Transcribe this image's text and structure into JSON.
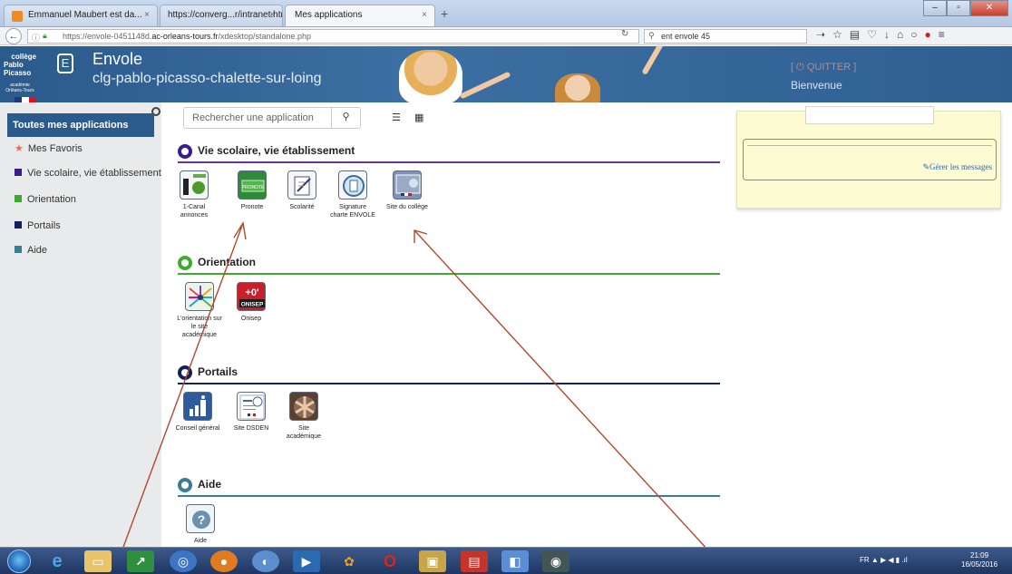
{
  "browser": {
    "tabs": [
      {
        "label": "Emmanuel Maubert est da...",
        "active": false
      },
      {
        "label": "https://converg...r/intranet.html",
        "active": false
      },
      {
        "label": "Mes applications",
        "active": true
      }
    ],
    "tab_close": "×",
    "new_tab": "+",
    "url_prefix": "https://envole-0451148d.",
    "url_domain": "ac-orleans-tours.fr",
    "url_path": "/xdesktop/standalone.php",
    "search_value": "ent envole 45"
  },
  "header": {
    "logo_line1": "collège",
    "logo_line2": "Pablo Picasso",
    "logo_academy": "académie Orléans-Tours",
    "app_name": "Envole",
    "site_name": "clg-pablo-picasso-chalette-sur-loing",
    "quit": "[ ⏻  QUITTER ]",
    "welcome": "Bienvenue"
  },
  "sidebar": {
    "title": "Toutes mes applications",
    "items": [
      {
        "label": "Mes Favoris",
        "color": "#e26d5c",
        "icon": "star-icon"
      },
      {
        "label": "Vie scolaire, vie établissement",
        "color": "#3a1c8f",
        "icon": "square-icon"
      },
      {
        "label": "Orientation",
        "color": "#3fab2e",
        "icon": "square-icon"
      },
      {
        "label": "Portails",
        "color": "#13225c",
        "icon": "square-icon"
      },
      {
        "label": "Aide",
        "color": "#3b7d95",
        "icon": "square-icon"
      }
    ]
  },
  "search": {
    "placeholder": "Rechercher une application"
  },
  "sections": [
    {
      "title": "Vie scolaire, vie établissement",
      "color": "#6a3596",
      "apps": [
        {
          "label": "1-Canal annonces"
        },
        {
          "label": "Pronote",
          "icon_text": "PRONOTE"
        },
        {
          "label": "Scolarité"
        },
        {
          "label": "Signature charte ENVOLE"
        },
        {
          "label": "Site du collège"
        }
      ]
    },
    {
      "title": "Orientation",
      "color": "#3fab2e",
      "apps": [
        {
          "label": "L'orientation sur le site académique"
        },
        {
          "label": "Onisep",
          "icon_text": "ONISEP"
        }
      ]
    },
    {
      "title": "Portails",
      "color": "#13225c",
      "apps": [
        {
          "label": "Conseil général"
        },
        {
          "label": "Site DSDEN"
        },
        {
          "label": "Site académique"
        }
      ]
    },
    {
      "title": "Aide",
      "color": "#3b7d95",
      "apps": [
        {
          "label": "Aide"
        }
      ]
    }
  ],
  "messages": {
    "manage": "Gérer les messages"
  },
  "taskbar": {
    "tray": "FR  ▲  ▶  ◀  ▮  .ıl",
    "time": "21:09",
    "date": "16/05/2016"
  }
}
